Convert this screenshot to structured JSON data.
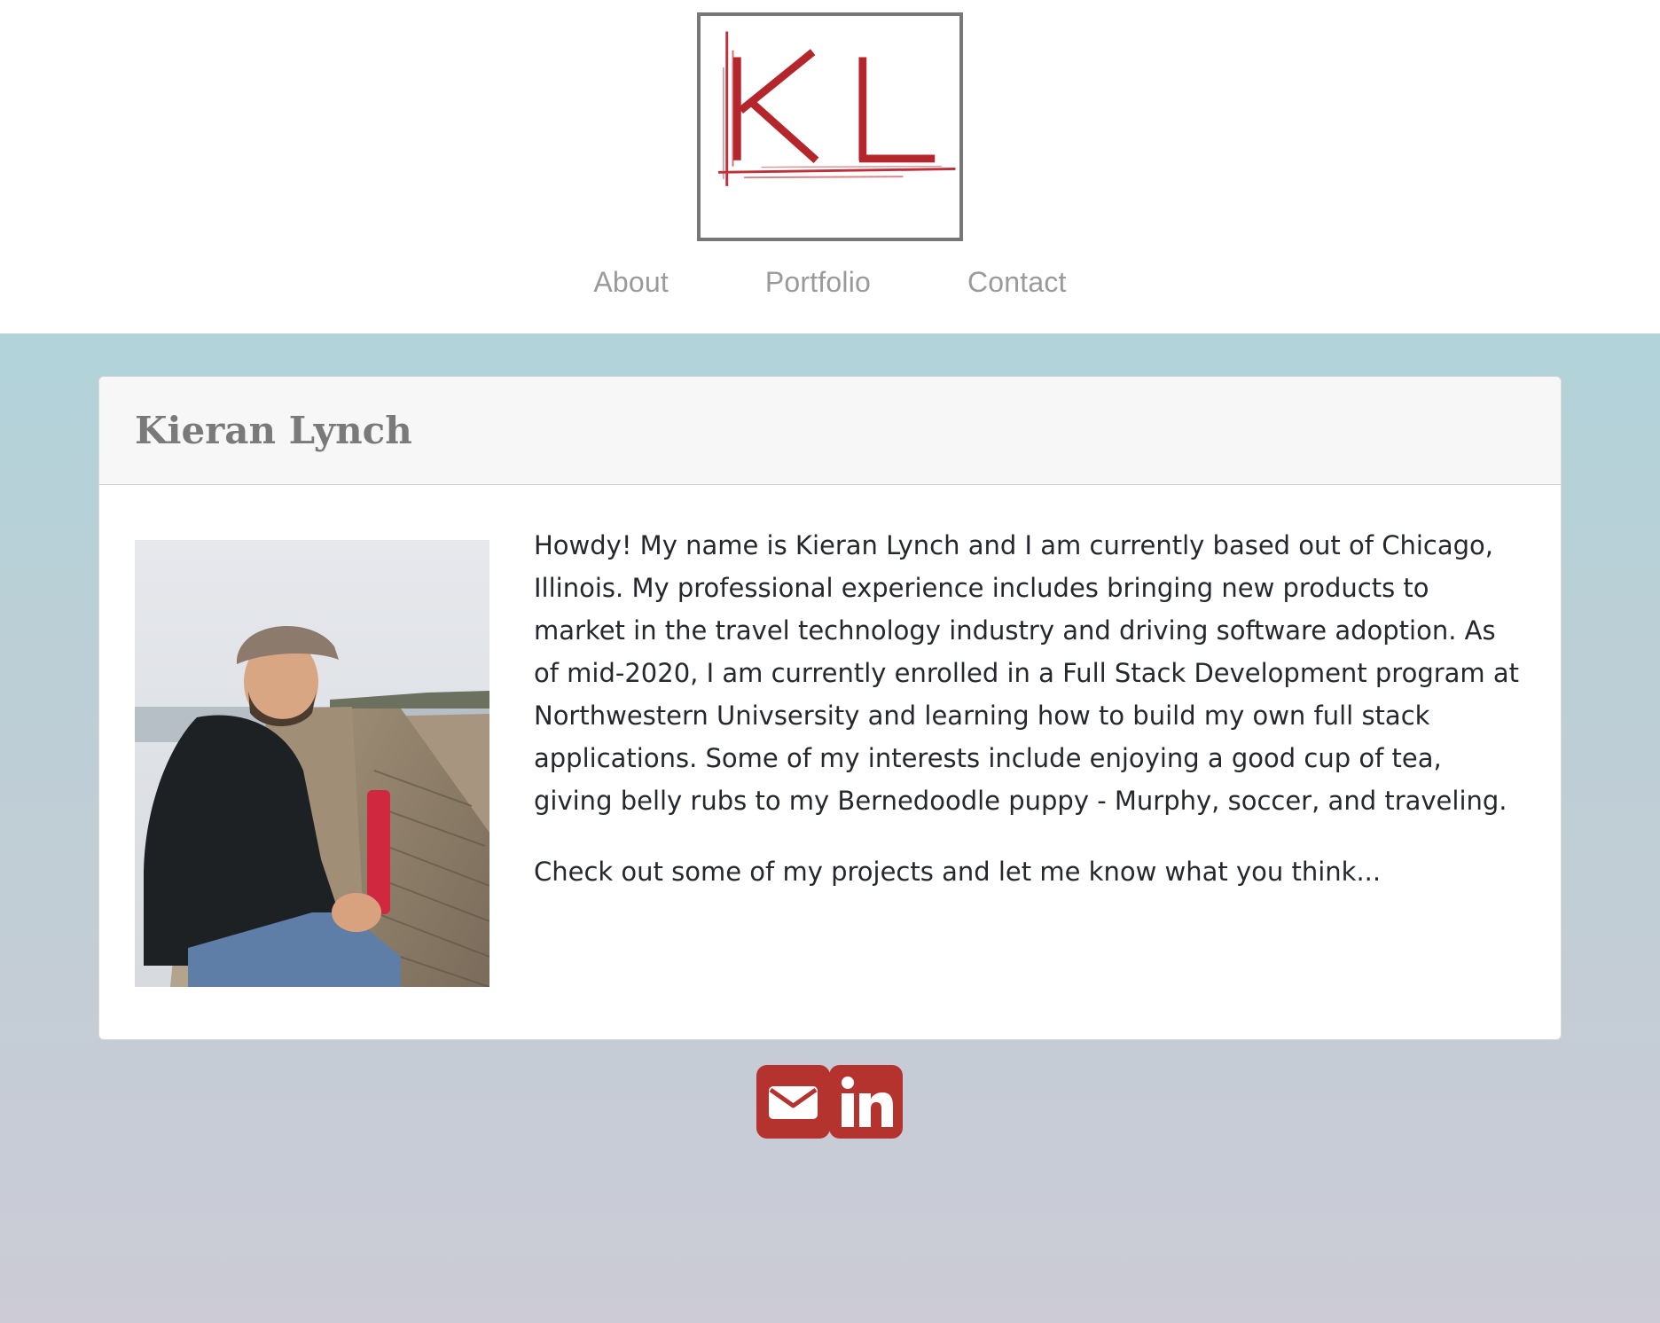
{
  "header": {
    "logo_text": "KL",
    "nav": [
      {
        "label": "About"
      },
      {
        "label": "Portfolio"
      },
      {
        "label": "Contact"
      }
    ]
  },
  "card": {
    "title": "Kieran Lynch",
    "bio_paragraphs": [
      "Howdy! My name is Kieran Lynch and I am currently based out of Chicago, Illinois. My professional experience includes bringing new products to market in the travel technology industry and driving software adoption. As of mid-2020, I am currently enrolled in a Full Stack Development program at Northwestern Univsersity and learning how to build my own full stack applications. Some of my interests include enjoying a good cup of tea, giving belly rubs to my Bernedoodle puppy - Murphy, soccer, and traveling.",
      "Check out some of my projects and let me know what you think..."
    ]
  },
  "social": {
    "icons": [
      "envelope-icon",
      "linkedin-icon"
    ]
  },
  "colors": {
    "accent": "#b5332e",
    "logo_border": "#777777",
    "nav_text": "#9a9a9a",
    "title_text": "#7a7a7a",
    "body_text": "#25282c",
    "gradient_top": "#a6d8dd",
    "gradient_bottom": "#cccbd6"
  }
}
